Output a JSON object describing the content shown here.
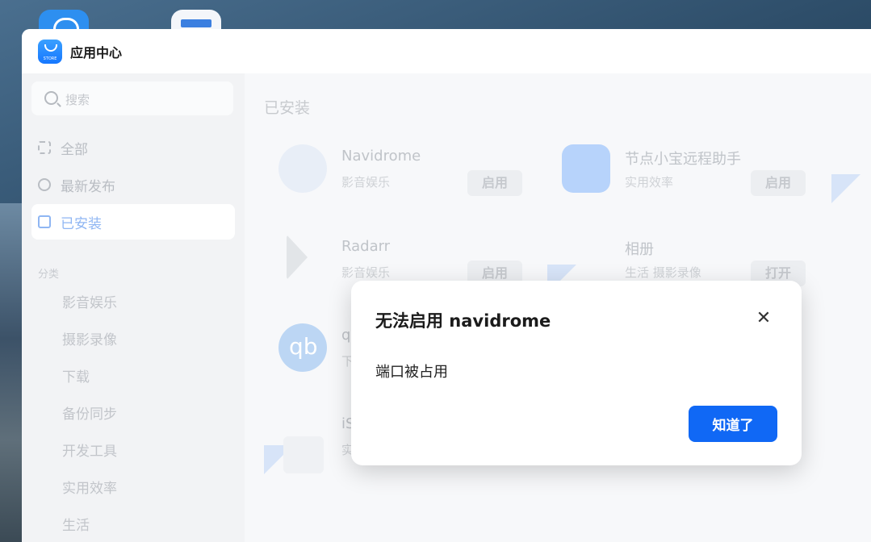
{
  "window": {
    "title": "应用中心",
    "logo_text": "STORE"
  },
  "sidebar": {
    "search_placeholder": "搜索",
    "nav": [
      {
        "label": "全部",
        "icon": "grid-icon"
      },
      {
        "label": "最新发布",
        "icon": "clock-icon"
      },
      {
        "label": "已安装",
        "icon": "installed-icon",
        "active": true
      }
    ],
    "category_header": "分类",
    "categories": [
      "影音娱乐",
      "摄影录像",
      "下载",
      "备份同步",
      "开发工具",
      "实用效率",
      "生活"
    ]
  },
  "main": {
    "heading": "已安装",
    "apps": [
      {
        "name": "Navidrome",
        "category": "影音娱乐",
        "button": "启用"
      },
      {
        "name": "节点小宝远程助手",
        "category": "实用效率",
        "button": "启用"
      },
      {
        "name": "Radarr",
        "category": "影音娱乐",
        "button": "启用"
      },
      {
        "name": "相册",
        "category": "生活 摄影录像",
        "button": "打开"
      },
      {
        "name": "q",
        "category": "下"
      },
      {
        "name": "iS",
        "category": "实"
      }
    ]
  },
  "dialog": {
    "title": "无法启用 navidrome",
    "message": "端口被占用",
    "ok_label": "知道了"
  },
  "colors": {
    "accent": "#1068f5",
    "titlebar": "#ffffff",
    "sidebar": "#f2f3f5"
  }
}
